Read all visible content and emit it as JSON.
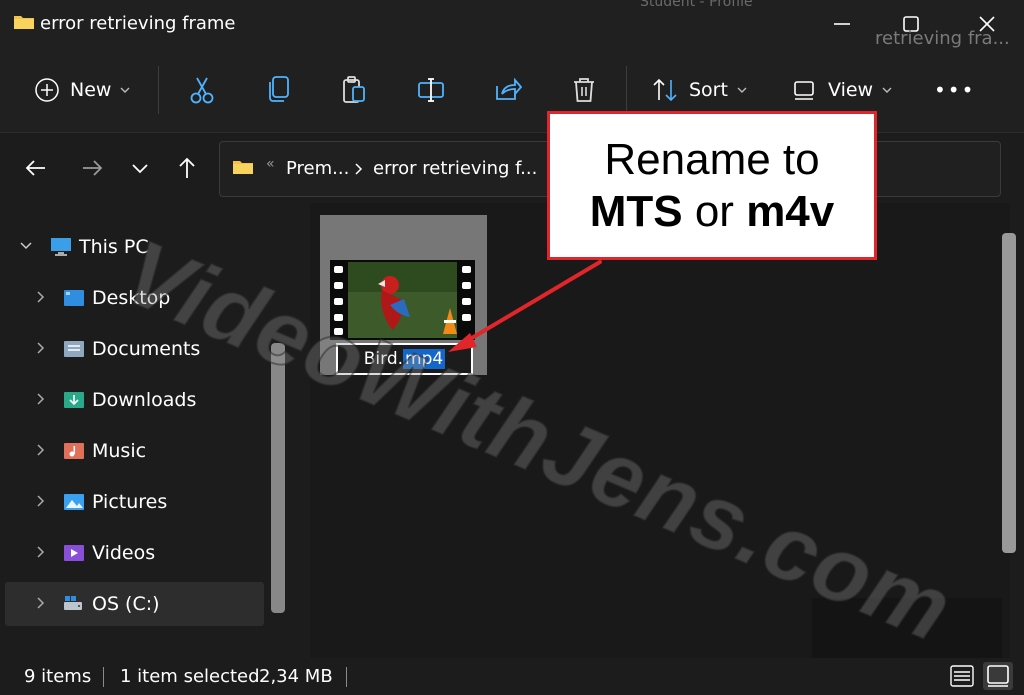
{
  "window": {
    "title": "error retrieving frame",
    "ghost_title": "Student - Profile"
  },
  "toolbar": {
    "new_label": "New",
    "sort_label": "Sort",
    "view_label": "View",
    "more_label": "•••"
  },
  "address": {
    "crumbs": [
      "Prem...",
      "error retrieving f..."
    ],
    "overflow": "«",
    "search_placeholder": "retrieving fra..."
  },
  "sidebar": {
    "root": "This PC",
    "items": [
      {
        "label": "Desktop",
        "icon": "desktop-icon"
      },
      {
        "label": "Documents",
        "icon": "documents-icon"
      },
      {
        "label": "Downloads",
        "icon": "downloads-icon"
      },
      {
        "label": "Music",
        "icon": "music-icon"
      },
      {
        "label": "Pictures",
        "icon": "pictures-icon"
      },
      {
        "label": "Videos",
        "icon": "videos-icon"
      },
      {
        "label": "OS (C:)",
        "icon": "drive-icon"
      }
    ]
  },
  "file": {
    "base_name": "Bird.",
    "extension": "mp4"
  },
  "status": {
    "items": "9 items",
    "selected": "1 item selected",
    "size": "2,34 MB"
  },
  "callout": {
    "line1": "Rename to",
    "opt1": "MTS",
    "or": " or ",
    "opt2": "m4v"
  },
  "watermark": "VideoWithJens.com",
  "colors": {
    "accent": "#1466c8",
    "callout_border": "#e0262b",
    "icon_blue": "#4fb3ff"
  }
}
